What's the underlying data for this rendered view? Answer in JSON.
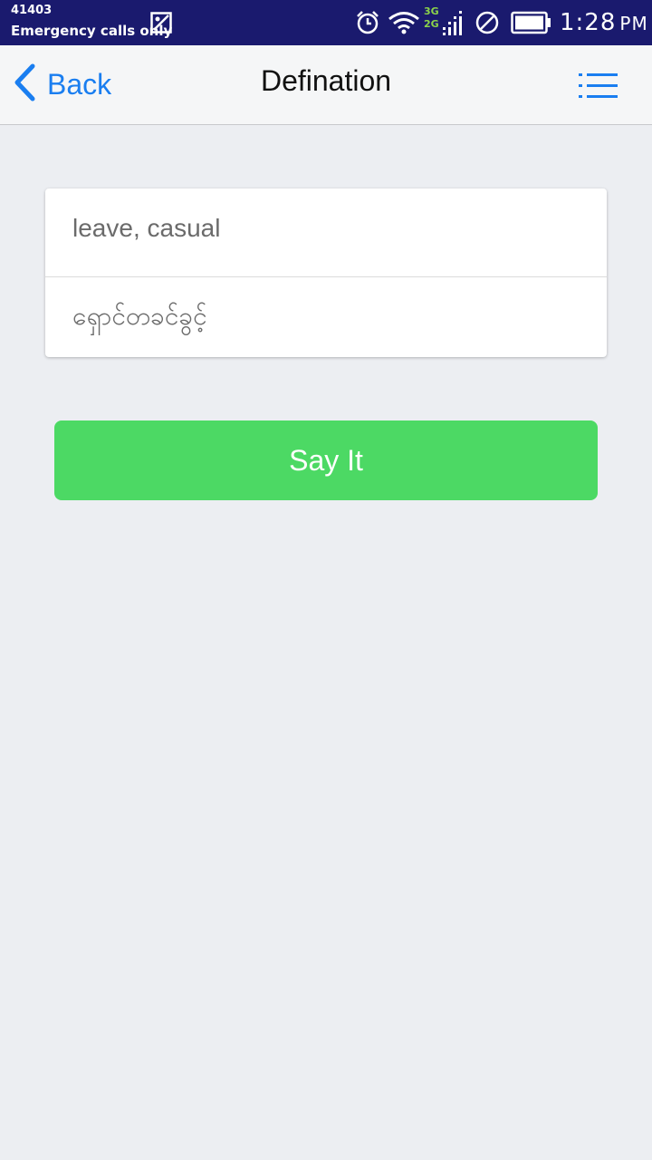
{
  "status_bar": {
    "carrier_code": "41403",
    "emergency_text": "Emergency calls only",
    "network_top": "3G",
    "network_bottom": "2G",
    "time": "1:28",
    "ampm": "PM",
    "icons": [
      "gallery-icon",
      "alarm-icon",
      "wifi-icon",
      "signal-icon",
      "do-not-disturb-icon",
      "battery-icon"
    ],
    "background_color": "#1a1a6e"
  },
  "nav": {
    "back_label": "Back",
    "title": "Defination",
    "menu_icon": "list-menu-icon",
    "accent_color": "#1a7ef0"
  },
  "definition": {
    "english": "leave, casual",
    "myanmar": "ရှောင်တခင်ခွင့်"
  },
  "actions": {
    "say_label": "Say It",
    "say_color": "#4cd964"
  }
}
